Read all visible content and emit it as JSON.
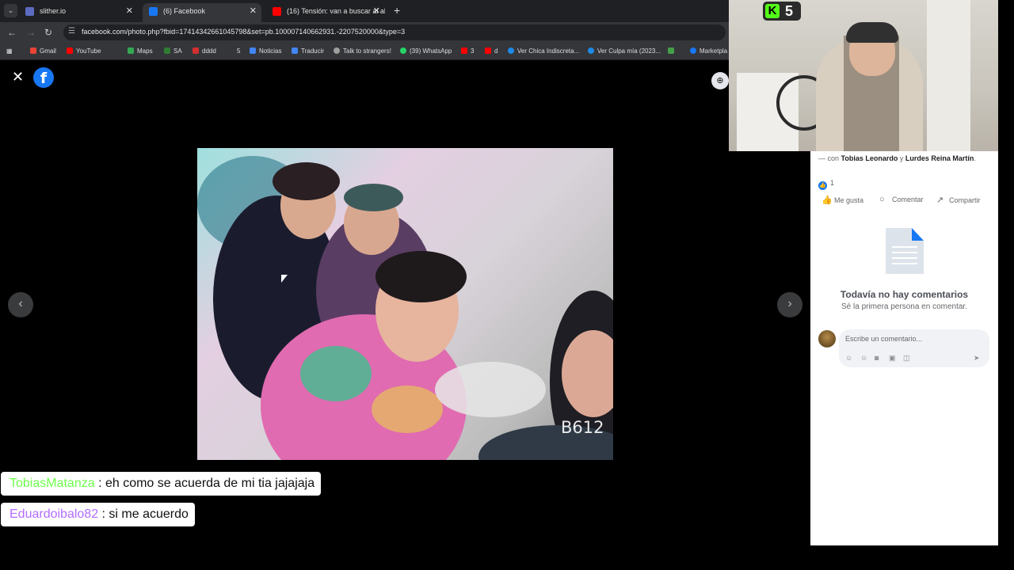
{
  "browser": {
    "tabs": [
      {
        "title": "slither.io",
        "active": false,
        "color": "#5c6bc0"
      },
      {
        "title": "(6) Facebook",
        "active": true,
        "color": "#1877f2"
      },
      {
        "title": "(16) Tensión: van a buscar al ab",
        "active": false,
        "color": "#ff0000"
      }
    ],
    "url": "facebook.com/photo.php?fbid=174143426610457​98&set=pb.100007140662931.-2207520000&type=3",
    "bookmarks": [
      {
        "label": "Gmail",
        "color": "#ea4335"
      },
      {
        "label": "YouTube",
        "color": "#ff0000"
      },
      {
        "label": "Maps",
        "color": "#34a853"
      },
      {
        "label": "SA",
        "color": "#2e7d32"
      },
      {
        "label": "dddd",
        "color": "#d32f2f"
      },
      {
        "label": "5",
        "color": "#9e9e9e"
      },
      {
        "label": "Noticias",
        "color": "#4285f4"
      },
      {
        "label": "Traducir",
        "color": "#4285f4"
      },
      {
        "label": "Talk to strangers!",
        "color": "#9e9e9e"
      },
      {
        "label": "(39) WhatsApp",
        "color": "#25d366"
      },
      {
        "label": "3",
        "color": "#ff0000"
      },
      {
        "label": "d",
        "color": "#ff0000"
      },
      {
        "label": "Ver Chica Indiscreta...",
        "color": "#1e88e5"
      },
      {
        "label": "Ver Culpa mía (2023...",
        "color": "#1e88e5"
      },
      {
        "label": "",
        "color": "#43a047"
      },
      {
        "label": "Marketpla",
        "color": "#1877f2"
      }
    ]
  },
  "photo_watermark": "B612",
  "kick": {
    "viewers": "5",
    "brand_color": "#53fc18"
  },
  "panel": {
    "with_prefix": "— con ",
    "tag1": "Tobias Leonardo",
    "with_and": " y ",
    "tag2": "Lurdes Reina Martín",
    "with_suffix": ".",
    "like_count": "1",
    "actions": {
      "like": "Me gusta",
      "comment": "Comentar",
      "share": "Compartir"
    },
    "no_comments_title": "Todavía no hay comentarios",
    "no_comments_sub": "Sé la primera persona en comentar.",
    "comment_placeholder": "Escribe un comentario..."
  },
  "chat": [
    {
      "user": "TobiasMatanza",
      "user_color": "#6dff4a",
      "message": " : eh como se acuerda de mi tia jajajaja"
    },
    {
      "user": "Eduardoibalo82",
      "user_color": "#b46cff",
      "message": " : si me acuerdo"
    }
  ]
}
